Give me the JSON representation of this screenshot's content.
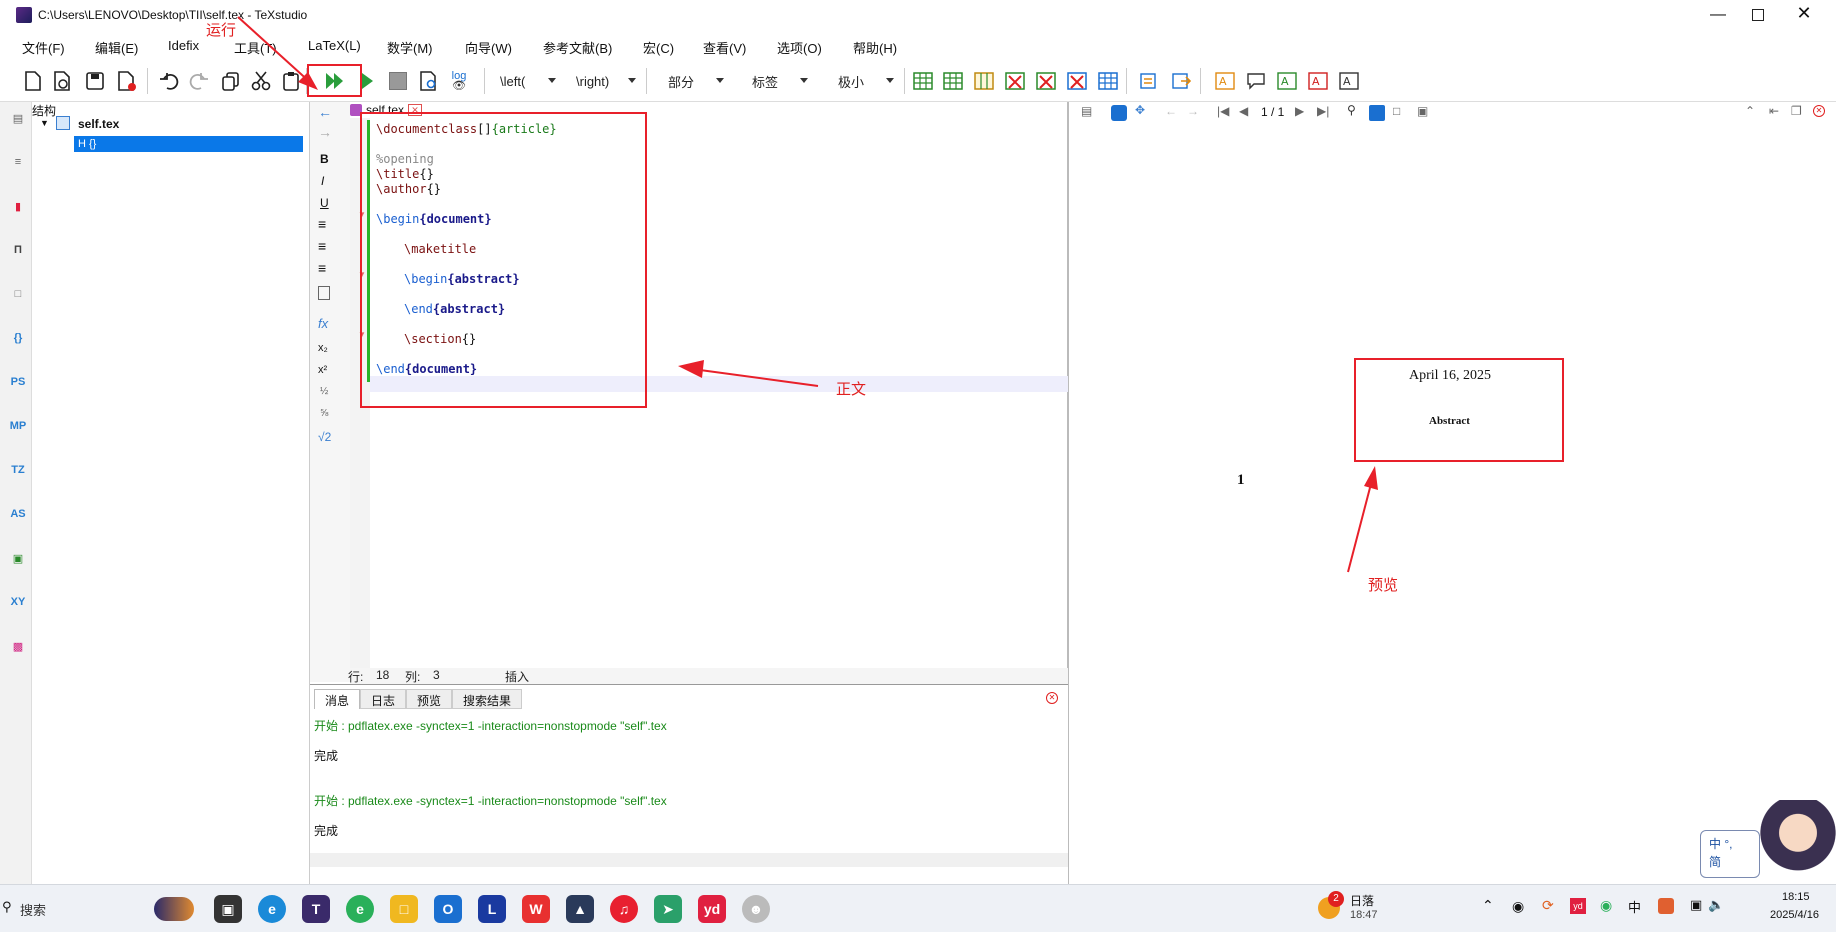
{
  "window": {
    "title": "C:\\Users\\LENOVO\\Desktop\\TII\\self.tex - TeXstudio"
  },
  "menu": [
    "文件(F)",
    "编辑(E)",
    "Idefix",
    "工具(T)",
    "LaTeX(L)",
    "数学(M)",
    "向导(W)",
    "参考文献(B)",
    "宏(C)",
    "查看(V)",
    "选项(O)",
    "帮助(H)"
  ],
  "toolbar": {
    "log_label": "log",
    "left_combo": "\\left(",
    "right_combo": "\\right)",
    "section_combo": "部分",
    "label_combo": "标签",
    "size_combo": "极小"
  },
  "left_strip": [
    "PS",
    "MP",
    "TZ",
    "AS",
    "XY"
  ],
  "structure": {
    "header": "结构",
    "file": "self.tex",
    "child": "H  {}"
  },
  "editor": {
    "tab": "self.tex",
    "lines": [
      {
        "cmd": "\\documentclass",
        "rest": "[]",
        "arg": "{article}"
      },
      {
        "comment": "%opening"
      },
      {
        "cmd": "\\title",
        "rest": "{}"
      },
      {
        "cmd": "\\author",
        "rest": "{}"
      },
      {
        "cmd": "\\begin",
        "arg": "{document}"
      },
      {
        "cmd": "\\maketitle"
      },
      {
        "cmd": "\\begin",
        "arg": "{abstract}"
      },
      {
        "cmd": "\\end",
        "arg": "{abstract}"
      },
      {
        "cmd": "\\section",
        "rest": "{}"
      },
      {
        "cmd": "\\end",
        "arg": "{document}"
      }
    ],
    "status": {
      "line_label": "行:",
      "line": "18",
      "col_label": "列:",
      "col": "3",
      "mode": "插入"
    }
  },
  "bottom": {
    "tabs": [
      "消息",
      "日志",
      "预览",
      "搜索结果"
    ],
    "messages": [
      {
        "text": "开始 : pdflatex.exe -synctex=1 -interaction=nonstopmode \"self\".tex",
        "color": "#1a8a1a"
      },
      {
        "text": "完成",
        "color": "#111111"
      },
      {
        "text": "开始 : pdflatex.exe -synctex=1 -interaction=nonstopmode \"self\".tex",
        "color": "#1a8a1a"
      },
      {
        "text": "完成",
        "color": "#111111"
      }
    ]
  },
  "preview": {
    "page_indicator": "1 / 1",
    "date": "April 16, 2025",
    "abstract": "Abstract",
    "section_number": "1"
  },
  "annotations": {
    "run": "运行",
    "body": "正文",
    "preview": "预览"
  },
  "taskbar": {
    "search": "搜索",
    "weather_badge": "2",
    "weather_title": "日落",
    "weather_time": "18:47",
    "clock_time": "18:15",
    "clock_date": "2025/4/16",
    "ime_top": "中 °,",
    "ime_bottom": "简"
  }
}
